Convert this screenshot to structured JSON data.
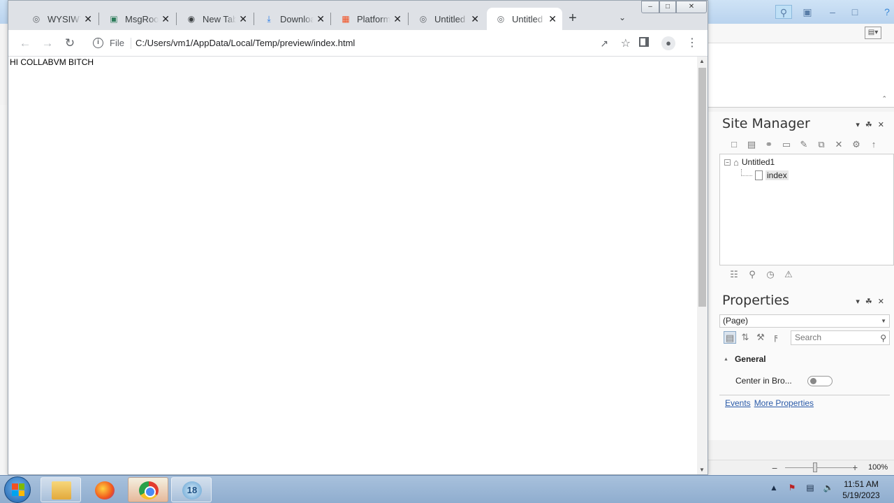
{
  "browser": {
    "tabs": [
      {
        "title": "WYSIWYG",
        "favicon": "globe-icon",
        "active": false
      },
      {
        "title": "MsgRoom",
        "favicon": "msg-app-icon",
        "active": false
      },
      {
        "title": "New Tab",
        "favicon": "chrome-icon",
        "active": false
      },
      {
        "title": "Downloads",
        "favicon": "download-icon",
        "active": false
      },
      {
        "title": "Platform",
        "favicon": "windows-logo-icon",
        "active": false
      },
      {
        "title": "Untitled",
        "favicon": "globe-icon",
        "active": false
      },
      {
        "title": "Untitled",
        "favicon": "globe-icon",
        "active": true
      }
    ],
    "new_tab_symbol": "+",
    "omnibox": {
      "scheme_label": "File",
      "url": "C:/Users/vm1/AppData/Local/Temp/preview/index.html"
    },
    "page": {
      "heading_text": "HI COLLABVM BITCH"
    }
  },
  "designer": {
    "site_manager": {
      "title": "Site Manager",
      "tree": {
        "root_label": "Untitled1",
        "child_label": "index"
      }
    },
    "properties": {
      "title": "Properties",
      "selected_object": "(Page)",
      "search_placeholder": "Search",
      "section_general": "General",
      "center_in_browser_label": "Center in Bro...",
      "center_in_browser_on": false,
      "links": {
        "events": "Events",
        "more_properties": "More Properties"
      }
    },
    "status": {
      "zoom_level": "100%"
    }
  },
  "taskbar": {
    "apps": [
      {
        "name": "explorer",
        "icon": "folder-icon"
      },
      {
        "name": "firefox",
        "icon": "firefox-icon"
      },
      {
        "name": "chrome",
        "icon": "chrome-icon",
        "active": true
      },
      {
        "name": "app18",
        "icon": "app-18-icon",
        "label": "18"
      }
    ],
    "clock": {
      "time": "11:51 AM",
      "date": "5/19/2023"
    }
  },
  "colors": {
    "chrome_tabstrip": "#dee1e6",
    "taskbar": "#a8c1dc",
    "link": "#2a5aa8"
  }
}
